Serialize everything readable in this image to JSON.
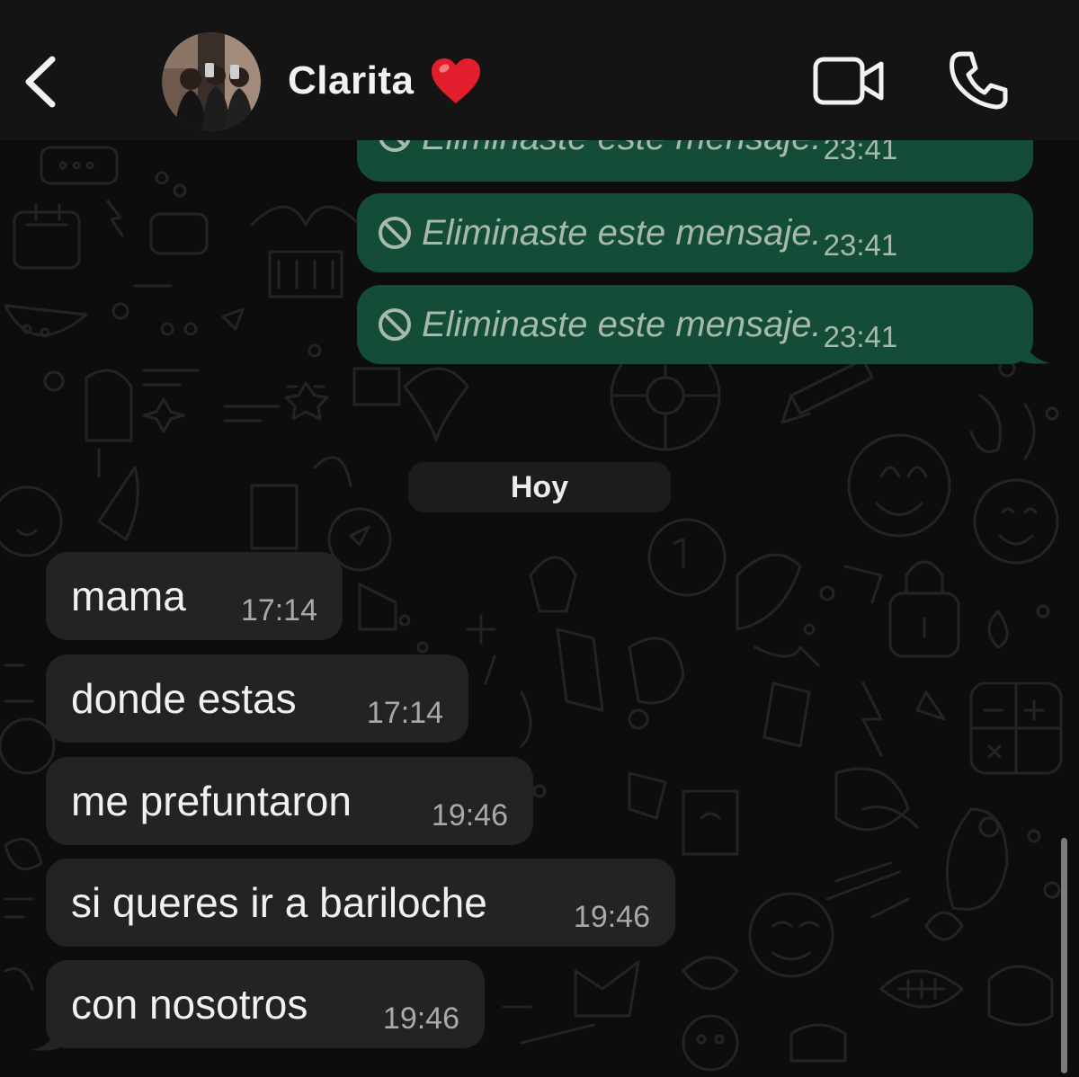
{
  "header": {
    "back_icon": "chevron-left-icon",
    "contact_name": "Clarita",
    "name_emoji": "heart-emoji",
    "video_icon": "video-camera-icon",
    "call_icon": "phone-icon"
  },
  "messages_outgoing": [
    {
      "text": "Eliminaste este mensaje.",
      "time": "23:41",
      "icon": "ban-icon"
    },
    {
      "text": "Eliminaste este mensaje.",
      "time": "23:41",
      "icon": "ban-icon"
    },
    {
      "text": "Eliminaste este mensaje.",
      "time": "23:41",
      "icon": "ban-icon"
    }
  ],
  "date_separator": "Hoy",
  "messages_incoming": [
    {
      "text": "mama",
      "time": "17:14"
    },
    {
      "text": "donde estas",
      "time": "17:14"
    },
    {
      "text": "me prefuntaron",
      "time": "19:46"
    },
    {
      "text": "si queres ir a bariloche",
      "time": "19:46"
    },
    {
      "text": "con nosotros",
      "time": "19:46"
    }
  ],
  "colors": {
    "background": "#0d0d0d",
    "header": "#141414",
    "outgoing_bubble": "#144d37",
    "incoming_bubble": "#232323",
    "deleted_text": "#a7b8ad"
  }
}
